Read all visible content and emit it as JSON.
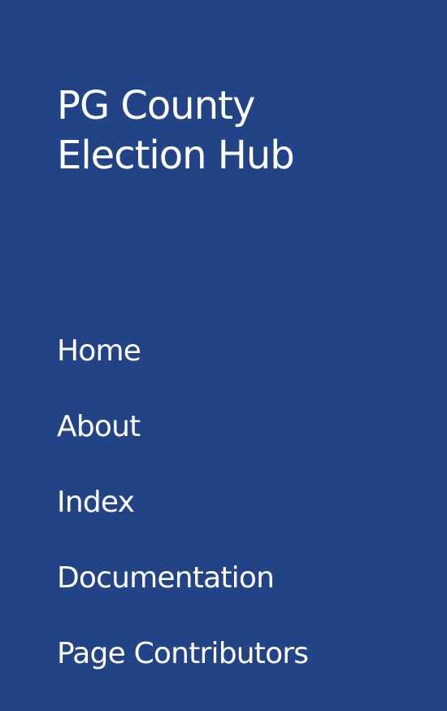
{
  "site": {
    "title_line1": "PG County",
    "title_line2": "Election Hub"
  },
  "nav": {
    "items": [
      {
        "label": "Home"
      },
      {
        "label": "About"
      },
      {
        "label": "Index"
      },
      {
        "label": "Documentation"
      },
      {
        "label": "Page Contributors"
      }
    ]
  },
  "colors": {
    "background": "#224486",
    "text": "#ffffff"
  }
}
